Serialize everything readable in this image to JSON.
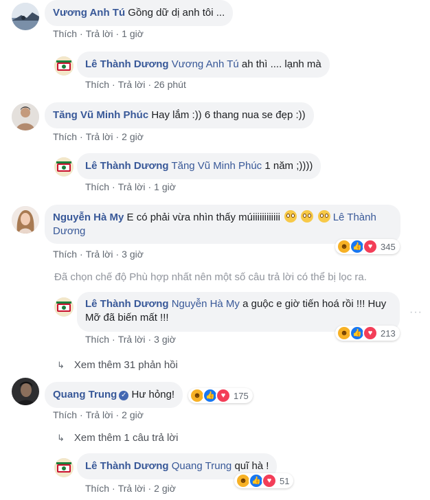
{
  "actions": {
    "like": "Thích",
    "reply": "Trả lời"
  },
  "comments": [
    {
      "author": "Vương Anh Tú",
      "text": "Gồng dữ dị anh tôi ...",
      "time": "1 giờ",
      "replies": [
        {
          "author": "Lê Thành Dương",
          "mention": "Vương Anh Tú",
          "text": "ah thì .... lạnh mà",
          "time": "26 phút"
        }
      ]
    },
    {
      "author": "Tăng Vũ Minh Phúc",
      "text": "Hay lắm :)) 6 thang nua se đẹp :))",
      "time": "2 giờ",
      "replies": [
        {
          "author": "Lê Thành Dương",
          "mention": "Tăng Vũ Minh Phúc",
          "text": "1 năm ;))))",
          "time": "1 giờ"
        }
      ]
    },
    {
      "author": "Nguyễn Hà My",
      "text": "E có phải vừa nhìn thấy múiiiiiiiiiiii",
      "mention_after": "Lê Thành Dương",
      "time": "3 giờ",
      "reaction_count": "345",
      "filter_note": "Đã chọn chế độ Phù hợp nhất nên một số câu trả lời có thể bị lọc ra.",
      "replies": [
        {
          "author": "Lê Thành Dương",
          "mention": "Nguyễn Hà My",
          "text": "a guộc e giờ tiến hoá rồi !!! Huy Mỡ đã biến mất !!!",
          "time": "3 giờ",
          "reaction_count": "213"
        }
      ],
      "more_replies": "Xem thêm 31 phản hồi"
    },
    {
      "author": "Quang Trung",
      "text": "Hư hỏng!",
      "time": "2 giờ",
      "reaction_count": "175",
      "more_replies": "Xem thêm 1 câu trả lời",
      "replies": [
        {
          "author": "Lê Thành Dương",
          "mention": "Quang Trung",
          "text": "quĩ hà !",
          "time": "2 giờ",
          "reaction_count": "51"
        }
      ]
    }
  ],
  "colors": {
    "author": "#385898",
    "bubble": "#f2f3f5",
    "meta": "#606770",
    "note": "#90949c"
  },
  "icons": {
    "verified": "verified-check-icon",
    "reply_arrow": "reply-arrow-icon",
    "options": "options-icon"
  }
}
